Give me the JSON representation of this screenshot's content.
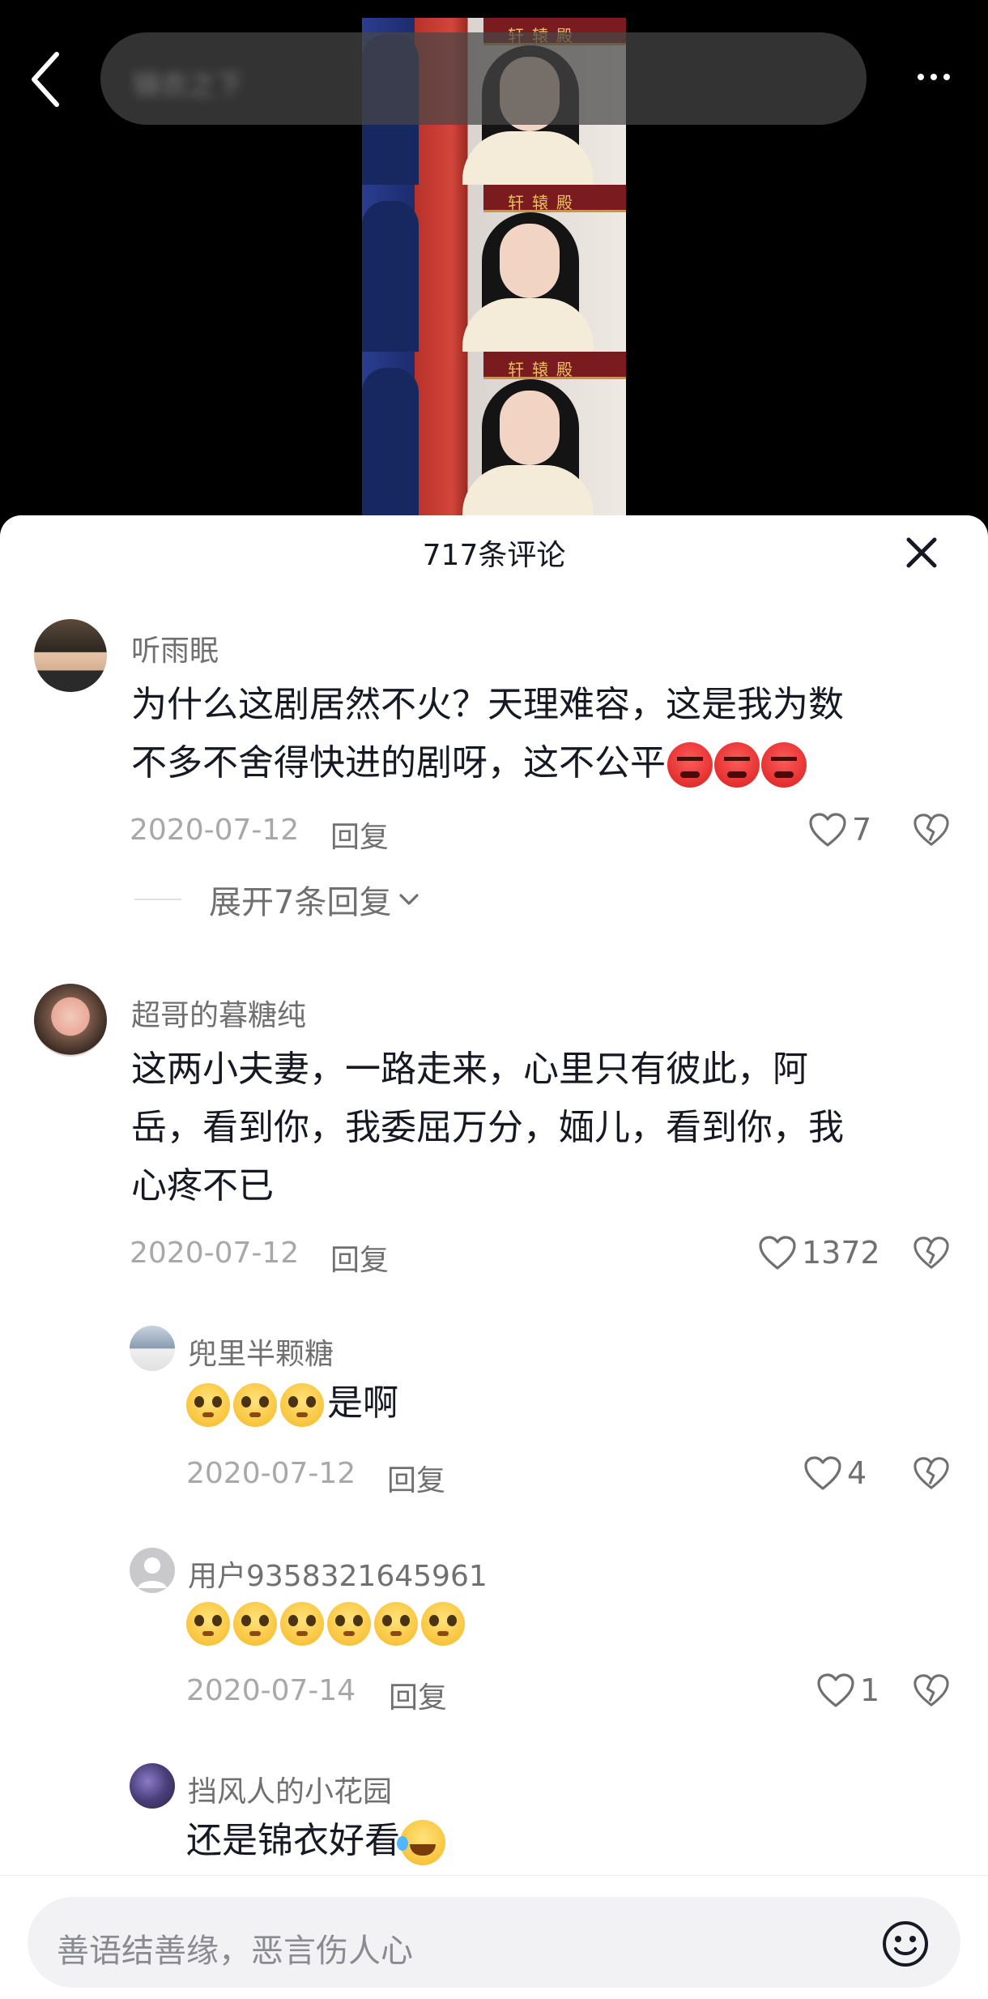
{
  "topbar": {
    "search_text": "锦衣之下"
  },
  "video": {
    "banner_text": "轩辕殿"
  },
  "sheet": {
    "title": "717条评论"
  },
  "comments": [
    {
      "username": "听雨眠",
      "text_line1": "为什么这剧居然不火？天理难容，这是我为数",
      "text_line2": "不多不舍得快进的剧呀，这不公平",
      "date": "2020-07-12",
      "reply_label": "回复",
      "likes": "7"
    },
    {
      "username": "超哥的暮糖纯",
      "text_line1": "这两小夫妻，一路走来，心里只有彼此，阿",
      "text_line2": "岳，看到你，我委屈万分，媔儿，看到你，我",
      "text_line3": "心疼不已",
      "date": "2020-07-12",
      "reply_label": "回复",
      "likes": "1372"
    }
  ],
  "expand_replies": {
    "label": "展开7条回复"
  },
  "replies": [
    {
      "username": "兜里半颗糖",
      "text": "是啊",
      "date": "2020-07-12",
      "reply_label": "回复",
      "likes": "4"
    },
    {
      "username": "用户9358321645961",
      "text": "",
      "date": "2020-07-14",
      "reply_label": "回复",
      "likes": "1"
    },
    {
      "username": "挡风人的小花园",
      "text": "还是锦衣好看"
    }
  ],
  "input": {
    "placeholder": "善语结善缘，恶言伤人心"
  },
  "icons": {
    "back": "back-arrow-icon",
    "more": "more-dots-icon",
    "close": "close-icon",
    "like": "heart-icon",
    "dislike": "broken-heart-icon",
    "expand": "chevron-down-icon",
    "emoji": "smiley-icon"
  },
  "colors": {
    "primary_text": "#161823",
    "secondary_text": "#707070",
    "meta_text": "#a8a8a8",
    "sheet_bg": "#ffffff",
    "input_bg": "#f2f2f4"
  }
}
